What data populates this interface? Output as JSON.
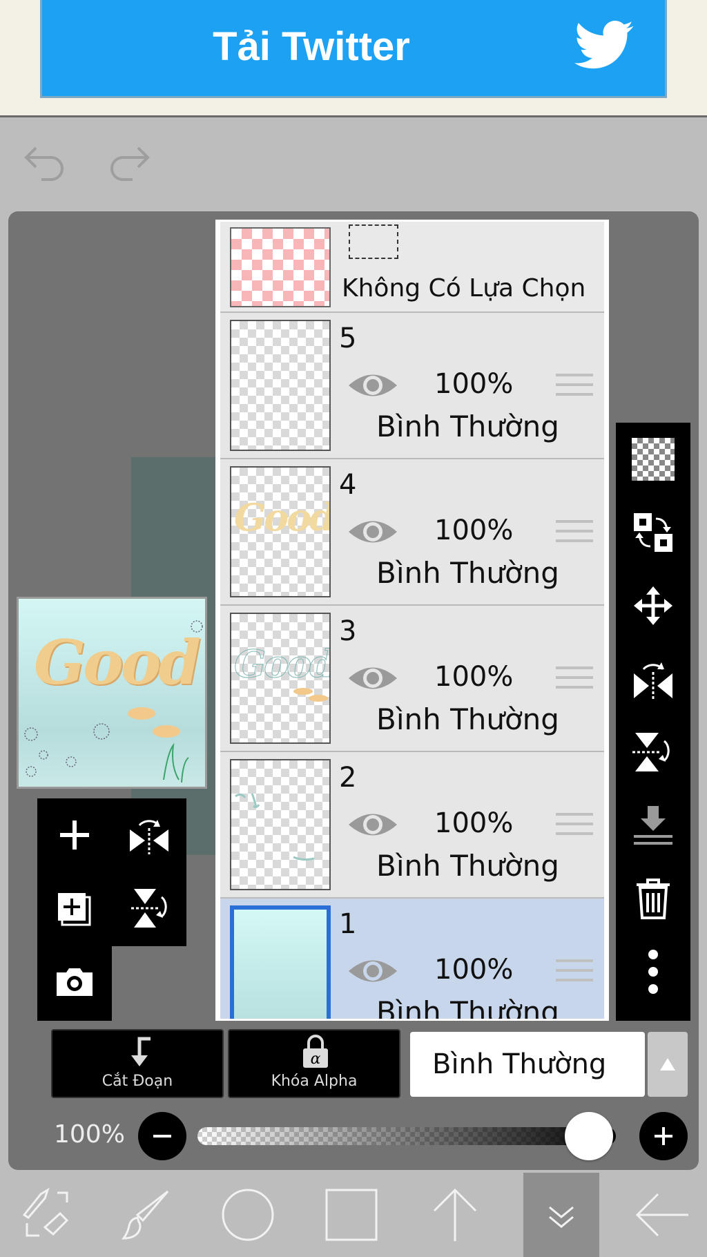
{
  "ad": {
    "text": "Tải Twitter",
    "icon": "twitter-bird-icon",
    "color": "#1da1f2"
  },
  "history": {
    "undo_icon": "undo-icon",
    "redo_icon": "redo-icon"
  },
  "canvas_preview": {
    "word": "Good"
  },
  "selection_layer": {
    "label": "Không Có Lựa Chọn"
  },
  "layers": [
    {
      "number": "5",
      "opacity": "100%",
      "blend": "Bình Thường",
      "visible": true,
      "active": false
    },
    {
      "number": "4",
      "opacity": "100%",
      "blend": "Bình Thường",
      "visible": true,
      "active": false
    },
    {
      "number": "3",
      "opacity": "100%",
      "blend": "Bình Thường",
      "visible": true,
      "active": false
    },
    {
      "number": "2",
      "opacity": "100%",
      "blend": "Bình Thường",
      "visible": true,
      "active": false
    },
    {
      "number": "1",
      "opacity": "100%",
      "blend": "Bình Thường",
      "visible": true,
      "active": true
    }
  ],
  "layer_controls": {
    "clip_label": "Cắt Đoạn",
    "alpha_lock_label": "Khóa Alpha",
    "blend_mode": "Bình Thường"
  },
  "opacity_control": {
    "value_text": "100%",
    "level": 1.0
  },
  "colors": {
    "accent": "#2a6fd6",
    "active_layer_bg": "#c8d6ec",
    "panel_bg": "#737373"
  }
}
